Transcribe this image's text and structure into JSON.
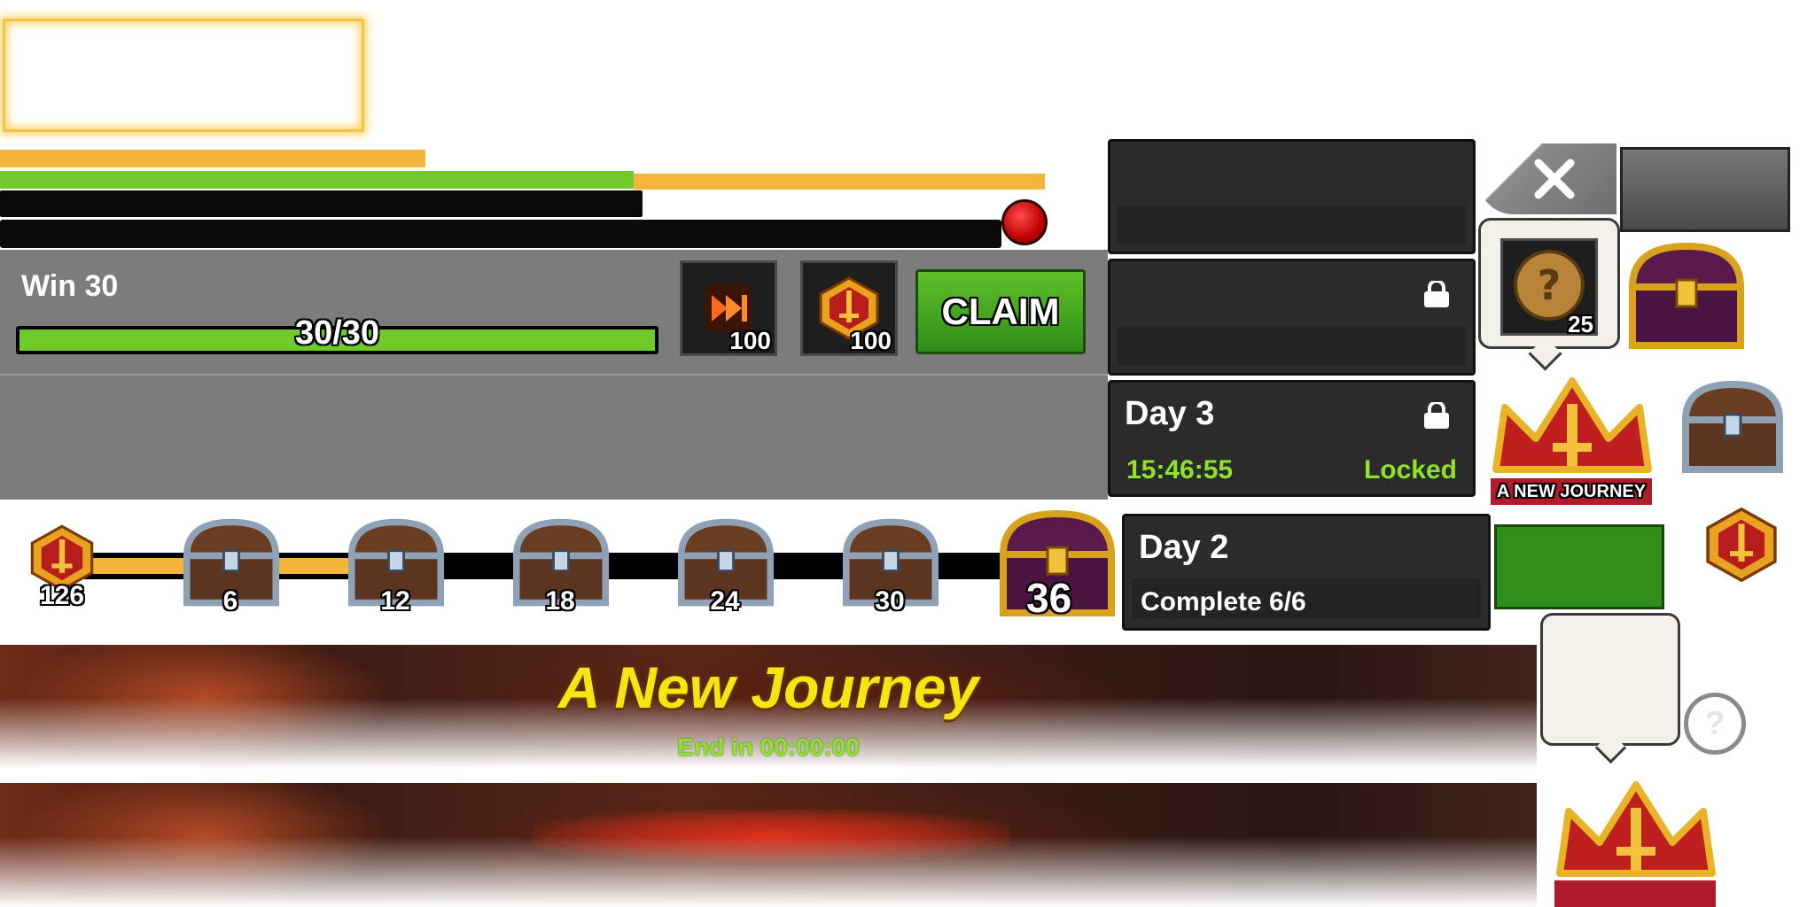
{
  "colors": {
    "accent_green": "#6fcb2a",
    "accent_orange": "#f2b53a",
    "timer_green": "#8ee32a",
    "title_yellow": "#f5e510",
    "panel_gray": "#7c7c7c",
    "card_dark": "#2b2b2b"
  },
  "quest": {
    "title": "Win 30",
    "progress_text": "30/30",
    "progress_fraction": 1.0,
    "rewards": [
      {
        "icon": "fast-forward-icon",
        "count": "100"
      },
      {
        "icon": "sword-emblem-icon",
        "count": "100"
      }
    ],
    "claim_label": "CLAIM"
  },
  "days": {
    "day3": {
      "title": "Day 3",
      "timer": "15:46:55",
      "status": "Locked"
    },
    "day2": {
      "title": "Day 2",
      "status": "Complete 6/6"
    }
  },
  "reward_tooltip": {
    "count": "25"
  },
  "event_badge": {
    "label": "A NEW JOURNEY"
  },
  "timeline": {
    "points": "126",
    "progress_fraction": 0.36,
    "milestones": [
      "6",
      "12",
      "18",
      "24",
      "30",
      "36"
    ]
  },
  "banner": {
    "title": "A New Journey",
    "timer": "End in 00:00:00"
  }
}
